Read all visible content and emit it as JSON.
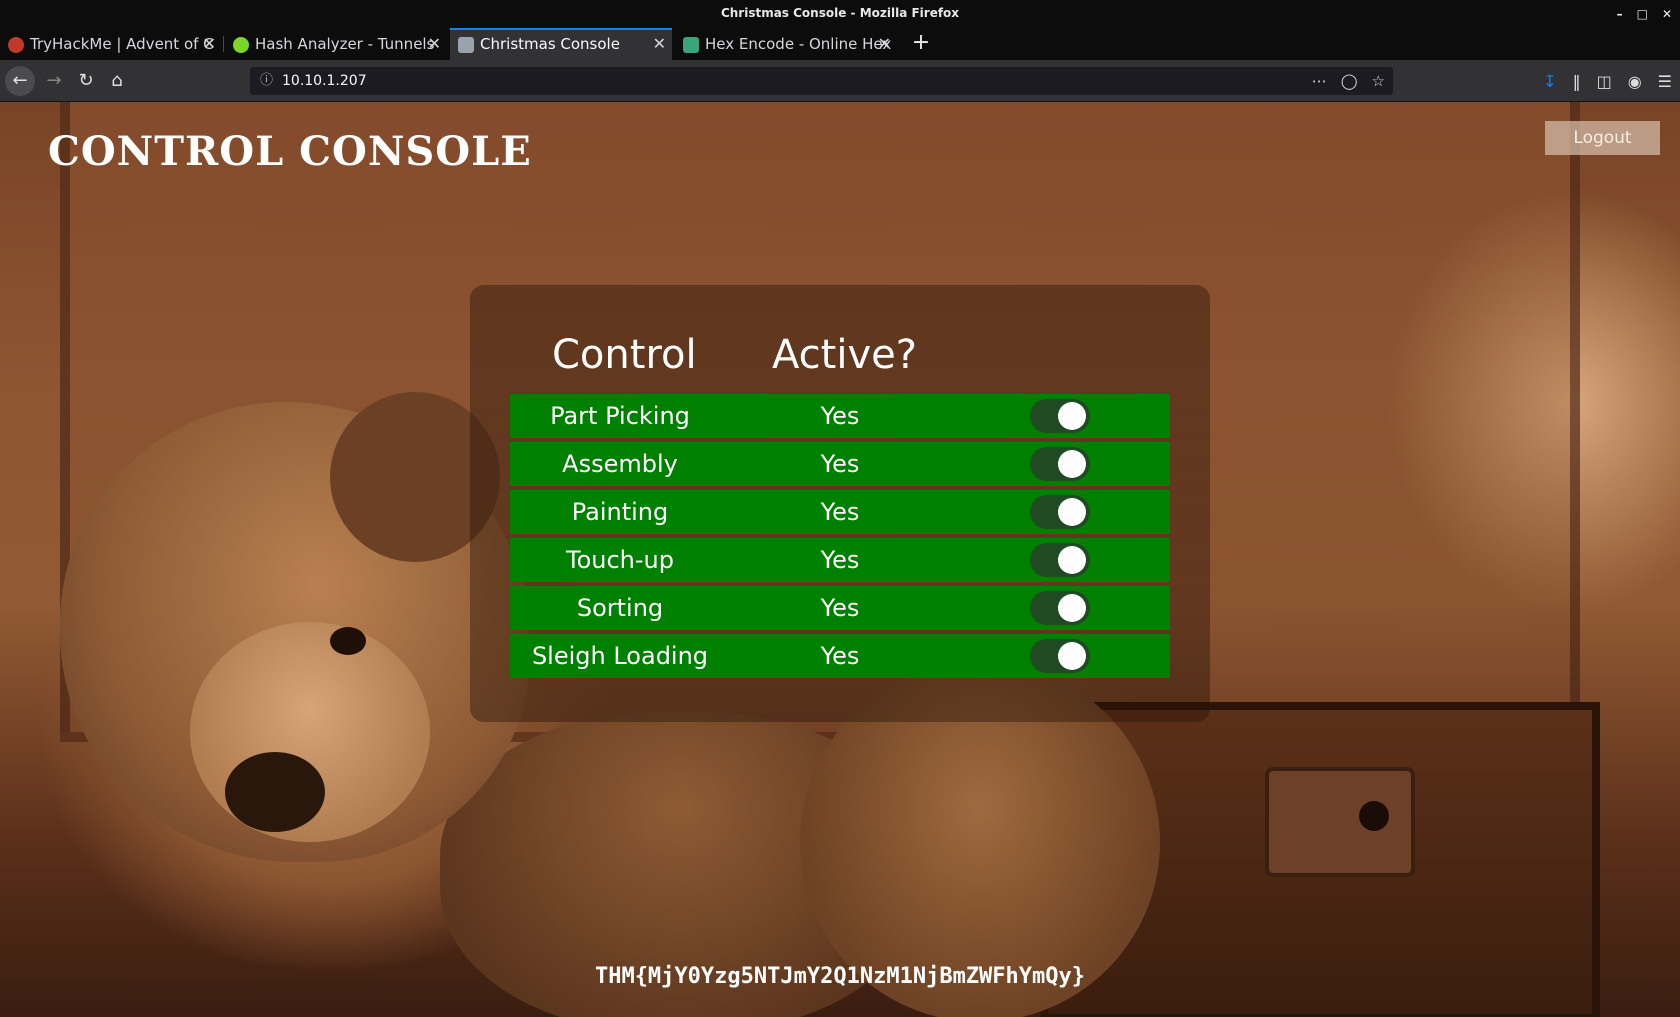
{
  "window": {
    "title": "Christmas Console - Mozilla Firefox"
  },
  "tabs": [
    {
      "label": "TryHackMe | Advent of C",
      "favicon_color": "#c0392b"
    },
    {
      "label": "Hash Analyzer - Tunnels",
      "favicon_color": "#7bd628"
    },
    {
      "label": "Christmas Console",
      "favicon_color": "#9aa3ad"
    },
    {
      "label": "Hex Encode - Online Hex",
      "favicon_color": "#3aa57a"
    }
  ],
  "navbar": {
    "url": "10.10.1.207"
  },
  "page": {
    "title": "CONTROL CONSOLE",
    "logout_label": "Logout",
    "table": {
      "headers": [
        "Control",
        "Active?"
      ],
      "rows": [
        {
          "control": "Part Picking",
          "active": "Yes",
          "enabled": true
        },
        {
          "control": "Assembly",
          "active": "Yes",
          "enabled": true
        },
        {
          "control": "Painting",
          "active": "Yes",
          "enabled": true
        },
        {
          "control": "Touch-up",
          "active": "Yes",
          "enabled": true
        },
        {
          "control": "Sorting",
          "active": "Yes",
          "enabled": true
        },
        {
          "control": "Sleigh Loading",
          "active": "Yes",
          "enabled": true
        }
      ]
    },
    "flag": "THM{MjY0Yzg5NTJmY2Q1NzM1NjBmZWFhYmQy}"
  },
  "colors": {
    "row_bg": "#008000",
    "accent": "#0a84ff"
  }
}
